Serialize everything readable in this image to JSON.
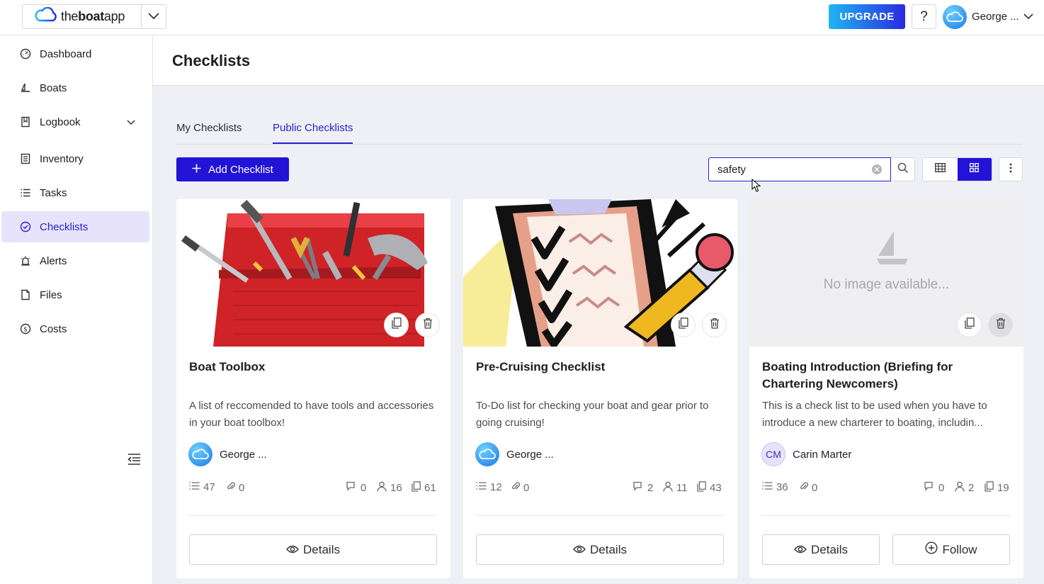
{
  "brand": {
    "name_prefix": "the",
    "name_bold": "boat",
    "name_suffix": "app"
  },
  "header": {
    "upgrade_label": "UPGRADE",
    "help_label": "?",
    "user_name": "George ..."
  },
  "sidebar": {
    "items": [
      {
        "label": "Dashboard",
        "icon": "gauge-icon"
      },
      {
        "label": "Boats",
        "icon": "sailboat-icon"
      },
      {
        "label": "Logbook",
        "icon": "book-icon"
      },
      {
        "label": "Inventory",
        "icon": "inventory-icon"
      },
      {
        "label": "Tasks",
        "icon": "list-icon"
      },
      {
        "label": "Checklists",
        "icon": "check-circle-icon",
        "active": true
      },
      {
        "label": "Alerts",
        "icon": "alarm-icon"
      },
      {
        "label": "Files",
        "icon": "file-icon"
      },
      {
        "label": "Costs",
        "icon": "dollar-icon"
      }
    ]
  },
  "page": {
    "title": "Checklists"
  },
  "tabs": [
    {
      "label": "My Checklists"
    },
    {
      "label": "Public Checklists",
      "active": true
    }
  ],
  "toolbar": {
    "add_label": "Add Checklist",
    "search_value": "safety",
    "search_placeholder": "Search"
  },
  "cards": [
    {
      "title": "Boat Toolbox",
      "description": "A list of reccomended to have tools and accessories in your boat toolbox!",
      "author": "George ...",
      "stats": {
        "items": "47",
        "attachments": "0",
        "comments": "0",
        "followers": "16",
        "copies": "61"
      },
      "buttons": [
        "Details"
      ]
    },
    {
      "title": "Pre-Cruising Checklist",
      "description": "To-Do list for checking your boat and gear prior to going cruising!",
      "author": "George ...",
      "stats": {
        "items": "12",
        "attachments": "0",
        "comments": "2",
        "followers": "11",
        "copies": "43"
      },
      "buttons": [
        "Details"
      ]
    },
    {
      "title": "Boating Introduction (Briefing for Chartering Newcomers)",
      "description": "This is a check list to be used when you have to introduce a new charterer to boating, includin...",
      "author": "Carin Marter",
      "author_initials": "CM",
      "no_image_text": "No image available...",
      "stats": {
        "items": "36",
        "attachments": "0",
        "comments": "0",
        "followers": "2",
        "copies": "19"
      },
      "buttons": [
        "Details",
        "Follow"
      ]
    }
  ],
  "colors": {
    "primary": "#2213d6",
    "accent": "#2a1fcf",
    "active_bg": "#e7e3fb"
  }
}
